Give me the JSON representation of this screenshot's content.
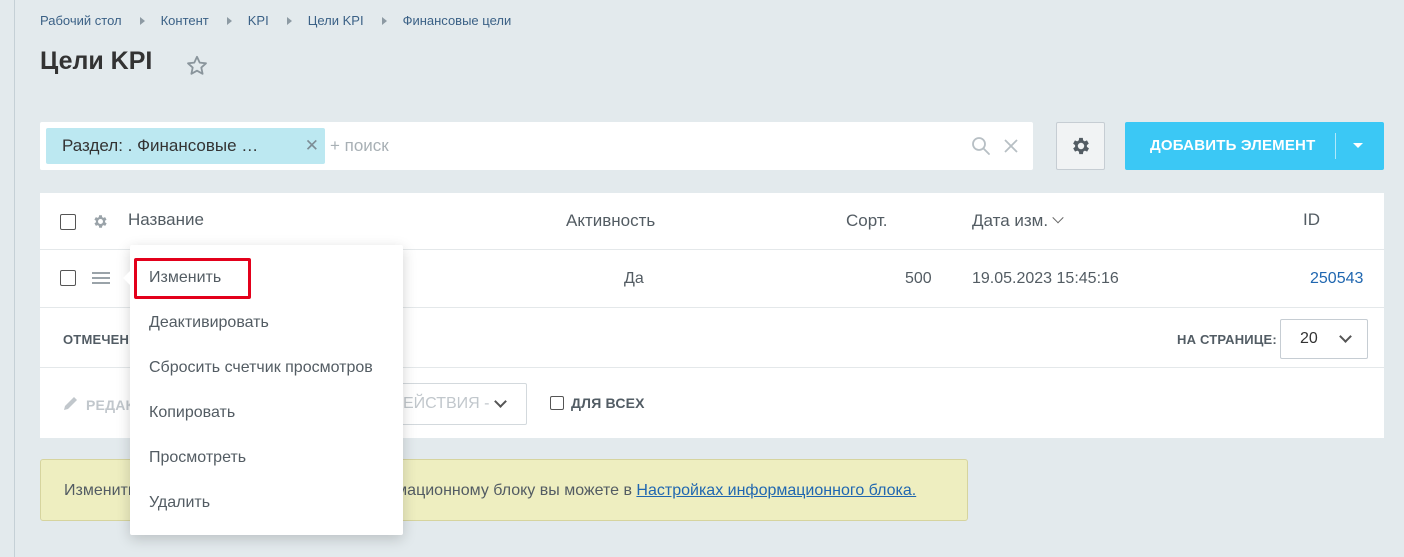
{
  "breadcrumb": [
    "Рабочий стол",
    "Контент",
    "KPI",
    "Цели KPI",
    "Финансовые цели"
  ],
  "page_title": "Цели KPI",
  "filter": {
    "tag_label": "Раздел: . Финансовые …",
    "search_placeholder": "+ поиск"
  },
  "toolbar": {
    "add_label": "ДОБАВИТЬ ЭЛЕМЕНТ"
  },
  "grid": {
    "columns": {
      "name": "Название",
      "activity": "Активность",
      "sort": "Сорт.",
      "date": "Дата изм.",
      "id": "ID"
    },
    "rows": [
      {
        "activity": "Да",
        "sort": "500",
        "date": "19.05.2023 15:45:16",
        "id": "250543"
      }
    ],
    "footer": {
      "selected_label": "ОТМЕЧЕН",
      "per_page_label": "НА СТРАНИЦЕ:",
      "per_page_value": "20"
    },
    "actions": {
      "edit_label": "РЕДАК",
      "actions_select": "ЕЙСТВИЯ -",
      "for_all_label": "ДЛЯ ВСЕХ"
    }
  },
  "notice": {
    "text_left": "Изменить",
    "text_mid": "мационному блоку вы можете в ",
    "link": "Настройках информационного блока."
  },
  "context_menu": {
    "items": [
      "Изменить",
      "Деактивировать",
      "Сбросить счетчик просмотров",
      "Копировать",
      "Просмотреть",
      "Удалить"
    ]
  },
  "colors": {
    "accent": "#3bc8f5",
    "tag_bg": "#bce8f1",
    "highlight": "#e3001b",
    "link": "#2067b0"
  }
}
